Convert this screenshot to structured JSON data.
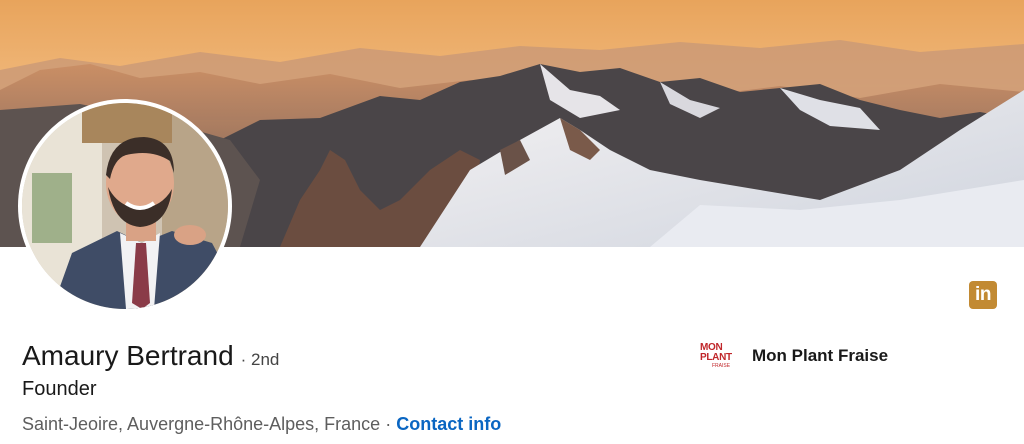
{
  "profile": {
    "name": "Amaury Bertrand",
    "degree": "· 2nd",
    "headline": "Founder",
    "location": "Saint-Jeoire, Auvergne-Rhône-Alpes, France",
    "separator": "·",
    "contact_label": "Contact info"
  },
  "company": {
    "name": "Mon Plant Fraise",
    "logo_line1": "MON PLANT",
    "logo_line2": "FRAISE"
  },
  "linkedin_badge": {
    "label": "in",
    "icon": "linkedin-icon",
    "color": "#c28a33"
  },
  "colors": {
    "link": "#0a66c2",
    "text": "#191919",
    "muted": "#5e5e5e"
  }
}
